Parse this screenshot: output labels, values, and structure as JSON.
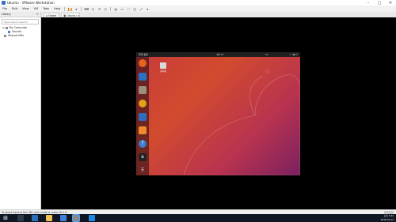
{
  "window": {
    "title": "Ubuntu - VMware Workstation"
  },
  "menubar": {
    "items": [
      "File",
      "Edit",
      "View",
      "VM",
      "Tabs",
      "Help"
    ]
  },
  "library": {
    "title": "Library",
    "search_placeholder": "Type here to search",
    "tree": [
      {
        "label": "My Computer",
        "indent": 0
      },
      {
        "label": "Ubuntu",
        "indent": 1
      },
      {
        "label": "Shared VMs",
        "indent": 0
      }
    ]
  },
  "tabs": [
    {
      "label": "Home",
      "active": false
    },
    {
      "label": "Ubuntu",
      "active": true
    }
  ],
  "ubuntu": {
    "topbar": {
      "activities": "현재 활동",
      "clock": "3월 12 ",
      "lang": "en",
      "sys_icons": "⚇ ◀) ⏻"
    },
    "desktop_icon": {
      "label": "휴지통"
    },
    "dock": [
      {
        "name": "firefox",
        "color": "#e8621c"
      },
      {
        "name": "thunderbird",
        "color": "#2a73c4"
      },
      {
        "name": "files",
        "color": "#9d8f7d"
      },
      {
        "name": "rhythmbox",
        "color": "#e0a21a"
      },
      {
        "name": "libreoffice-writer",
        "color": "#2f6dbf"
      },
      {
        "name": "software-center",
        "color": "#f08a2a"
      },
      {
        "name": "help",
        "color": "#3a7fd1"
      },
      {
        "name": "amazon",
        "color": "#222222"
      }
    ]
  },
  "statusbar": {
    "message": "To direct input to this VM, click inside or press Ctrl+G."
  },
  "taskbar": {
    "time": "오후 3:42",
    "date": "2018-03-12"
  }
}
